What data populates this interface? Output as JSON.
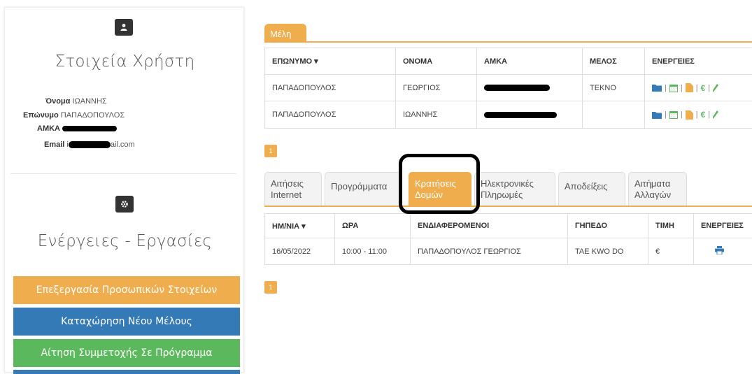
{
  "user_panel": {
    "heading": "Στοιχεία Χρήστη",
    "first_name_label": "Όνομα",
    "first_name_value": "ΙΩΑΝΝΗΣ",
    "last_name_label": "Επώνυμο",
    "last_name_value": "ΠΑΠΑΔΟΠΟΥΛΟΣ",
    "amka_label": "ΑΜΚΑ",
    "email_label": "Email",
    "email_prefix": "i",
    "email_suffix": "ail.com"
  },
  "actions_panel": {
    "heading": "Ενέργειες - Εργασίες",
    "buttons": [
      {
        "label": "Επεξεργασία Προσωπικών Στοιχείων",
        "color": "#f0ad4e"
      },
      {
        "label": "Καταχώρηση Νέου Μέλους",
        "color": "#337ab7"
      },
      {
        "label": "Αίτηση Συμμετοχής Σε Πρόγραμμα",
        "color": "#5cb85c"
      }
    ]
  },
  "members": {
    "tab_label": "Μέλη",
    "headers": [
      "ΕΠΩΝΥΜΟ ▾",
      "ΟΝΟΜΑ",
      "ΑΜΚΑ",
      "ΜΕΛΟΣ",
      "ΕΝΕΡΓΕΙΕΣ"
    ],
    "rows": [
      {
        "surname": "ΠΑΠΑΔΟΠΟΥΛΟΣ",
        "name": "ΓΕΩΡΓΙΟΣ",
        "member": "ΤΕΚΝΟ"
      },
      {
        "surname": "ΠΑΠΑΔΟΠΟΥΛΟΣ",
        "name": "ΙΩΑΝΝΗΣ",
        "member": ""
      }
    ],
    "page": "1"
  },
  "tabs": [
    {
      "label": "Αιτήσεις Internet"
    },
    {
      "label": "Προγράμματα"
    },
    {
      "label": "Κρατήσεις Δομών",
      "active": true
    },
    {
      "label": "Ηλεκτρονικές Πληρωμές"
    },
    {
      "label": "Αποδείξεις"
    },
    {
      "label": "Αιτήματα Αλλαγών"
    }
  ],
  "bookings": {
    "headers": [
      "ΗΜ/ΝΙΑ ▾",
      "ΩΡΑ",
      "ΕΝΔΙΑΦΕΡΟΜΕΝΟΙ",
      "ΓΗΠΕΔΟ",
      "ΤΙΜΗ",
      "ΕΝΕΡΓΕΙΕΣ"
    ],
    "rows": [
      {
        "date": "16/05/2022",
        "time": "10:00 - 11:00",
        "interested": "ΠΑΠΑΔΟΠΟΥΛΟΣ ΓΕΩΡΓΙΟΣ",
        "court": "TAE KWO DO",
        "price": "€"
      }
    ],
    "page": "1"
  },
  "colors": {
    "accent": "#f0ad4e",
    "primary": "#337ab7",
    "success": "#5cb85c"
  },
  "icons": [
    "user-icon",
    "gear-icon",
    "folder-icon",
    "calendar-icon",
    "file-icon",
    "euro-icon",
    "pencil-icon",
    "print-icon"
  ]
}
